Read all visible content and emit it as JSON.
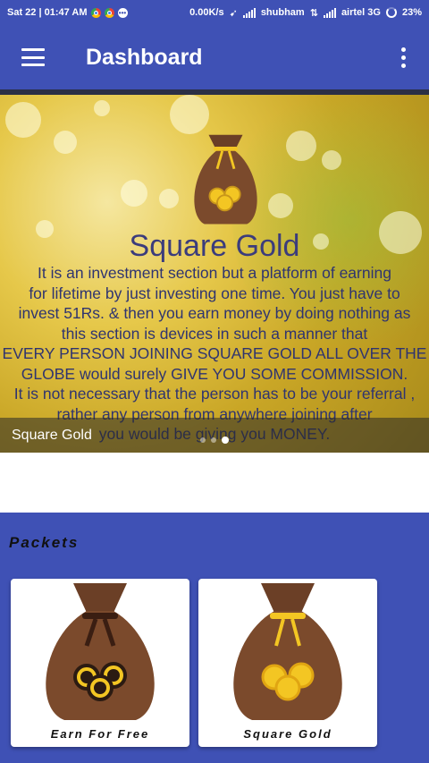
{
  "status_bar": {
    "time": "Sat 22 | 01:47 AM",
    "speed": "0.00K/s",
    "carrier1": "shubham",
    "carrier2": "airtel 3G",
    "battery": "23%"
  },
  "toolbar": {
    "title": "Dashboard",
    "menu_icon": "hamburger-menu-icon",
    "overflow_icon": "more-vert-icon"
  },
  "banner": {
    "title": "Square Gold",
    "description": "It is an investment section but a platform of earning\nfor lifetime by just investing one time. You just have to\ninvest 51Rs. & then you earn money by doing nothing as\nthis section is devices in such a manner that\nEVERY PERSON JOINING SQUARE GOLD ALL OVER THE\nGLOBE would surely GIVE YOU SOME COMMISSION.\nIt is not necessary that the person has to be your referral ,\nrather any person from anywhere joining after\nyou would be giving you MONEY.",
    "caption": "Square Gold",
    "slides_total": 3,
    "active_slide": 3
  },
  "packets": {
    "title": "Packets",
    "items": [
      {
        "label": "Earn For Free",
        "tie_color": "#3a1e12",
        "coin_color": "#f3c623",
        "coin_inner": "#2b1b12"
      },
      {
        "label": "Square Gold",
        "tie_color": "#f3c623",
        "coin_color": "#f3c623",
        "coin_inner": "#f7b21c"
      }
    ]
  },
  "colors": {
    "primary": "#3f51b5",
    "bag_brown": "#7b4a2c",
    "gold": "#f3c623"
  }
}
